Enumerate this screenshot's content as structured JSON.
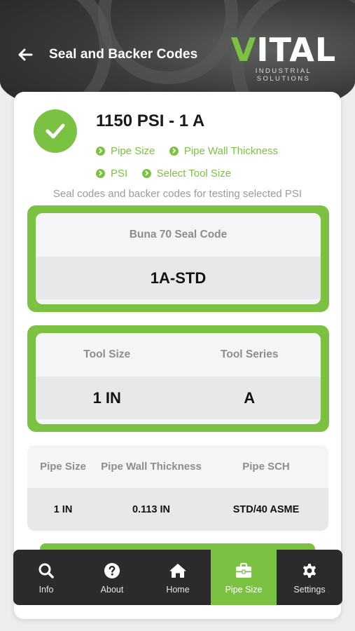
{
  "header": {
    "title": "Seal and Backer Codes",
    "logo_text": "VITAL",
    "logo_subtitle": "INDUSTRIAL SOLUTIONS"
  },
  "summary": {
    "title": "1150 PSI - 1 A",
    "steps": [
      "Pipe Size",
      "Pipe Wall Thickness",
      "PSI",
      "Select Tool Size"
    ],
    "description": "Seal codes and backer codes for testing selected PSI"
  },
  "seal_code": {
    "label": "Buna 70 Seal Code",
    "value": "1A-STD"
  },
  "tool": {
    "size_label": "Tool Size",
    "series_label": "Tool Series",
    "size_value": "1 IN",
    "series_value": "A"
  },
  "pipe": {
    "headers": [
      "Pipe Size",
      "Pipe Wall Thickness",
      "Pipe SCH"
    ],
    "values": [
      "1 IN",
      "0.113 IN",
      "STD/40 ASME"
    ]
  },
  "tabs": [
    {
      "label": "Info",
      "icon": "search-icon"
    },
    {
      "label": "About",
      "icon": "question-icon"
    },
    {
      "label": "Home",
      "icon": "home-icon"
    },
    {
      "label": "Pipe Size",
      "icon": "toolbox-icon",
      "active": true
    },
    {
      "label": "Settings",
      "icon": "gear-icon"
    }
  ],
  "colors": {
    "accent": "#7cc242",
    "tabbar": "#2b2b2b"
  }
}
